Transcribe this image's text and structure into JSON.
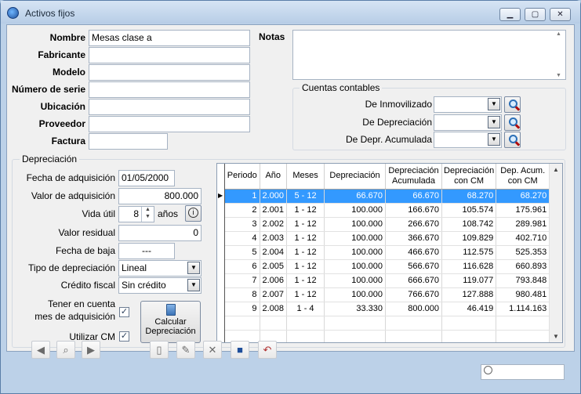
{
  "window": {
    "title": "Activos fijos"
  },
  "form": {
    "nombre_label": "Nombre",
    "nombre_value": "Mesas clase a",
    "fabricante_label": "Fabricante",
    "fabricante_value": "",
    "modelo_label": "Modelo",
    "modelo_value": "",
    "serie_label": "Número de serie",
    "serie_value": "",
    "ubicacion_label": "Ubicación",
    "ubicacion_value": "",
    "proveedor_label": "Proveedor",
    "proveedor_value": "",
    "factura_label": "Factura",
    "factura_value": "",
    "notas_label": "Notas",
    "notas_value": ""
  },
  "cuentas": {
    "title": "Cuentas contables",
    "inmovilizado_label": "De Inmovilizado",
    "depreciacion_label": "De Depreciación",
    "acumulada_label": "De Depr. Acumulada"
  },
  "depreciacion": {
    "title": "Depreciación",
    "fecha_adq_label": "Fecha de adquisición",
    "fecha_adq_value": "01/05/2000",
    "valor_adq_label": "Valor de adquisición",
    "valor_adq_value": "800.000",
    "vida_util_label": "Vida útil",
    "vida_util_value": "8",
    "vida_util_unit": "años",
    "valor_residual_label": "Valor residual",
    "valor_residual_value": "0",
    "fecha_baja_label": "Fecha de baja",
    "fecha_baja_value": "---",
    "tipo_label": "Tipo de depreciación",
    "tipo_value": "Lineal",
    "credito_label": "Crédito fiscal",
    "credito_value": "Sin crédito",
    "tener_cuenta_label_1": "Tener en cuenta",
    "tener_cuenta_label_2": "mes de adquisición",
    "tener_cuenta_checked": true,
    "utilizar_cm_label": "Utilizar CM",
    "utilizar_cm_checked": true,
    "calcular_label_1": "Calcular",
    "calcular_label_2": "Depreciación"
  },
  "table": {
    "headers": [
      "Periodo",
      "Año",
      "Meses",
      "Depreciación",
      "Depreciación Acumulada",
      "Depreciación con CM",
      "Dep. Acum. con CM"
    ],
    "rows": [
      [
        "1",
        "2.000",
        "5 - 12",
        "66.670",
        "66.670",
        "68.270",
        "68.270"
      ],
      [
        "2",
        "2.001",
        "1 - 12",
        "100.000",
        "166.670",
        "105.574",
        "175.961"
      ],
      [
        "3",
        "2.002",
        "1 - 12",
        "100.000",
        "266.670",
        "108.742",
        "289.981"
      ],
      [
        "4",
        "2.003",
        "1 - 12",
        "100.000",
        "366.670",
        "109.829",
        "402.710"
      ],
      [
        "5",
        "2.004",
        "1 - 12",
        "100.000",
        "466.670",
        "112.575",
        "525.353"
      ],
      [
        "6",
        "2.005",
        "1 - 12",
        "100.000",
        "566.670",
        "116.628",
        "660.893"
      ],
      [
        "7",
        "2.006",
        "1 - 12",
        "100.000",
        "666.670",
        "119.077",
        "793.848"
      ],
      [
        "8",
        "2.007",
        "1 - 12",
        "100.000",
        "766.670",
        "127.888",
        "980.481"
      ],
      [
        "9",
        "2.008",
        "1 - 4",
        "33.330",
        "800.000",
        "46.419",
        "1.114.163"
      ]
    ],
    "selected_row": 0
  },
  "toolbar": {
    "search_placeholder": ""
  }
}
